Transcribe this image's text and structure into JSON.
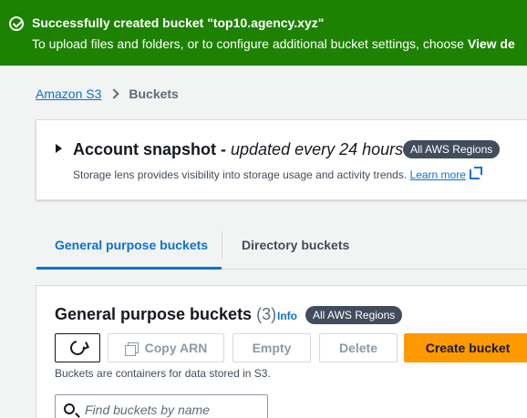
{
  "banner": {
    "title": "Successfully created bucket \"top10.agency.xyz\"",
    "message": "To upload files and folders, or to configure additional bucket settings, choose ",
    "message_bold": "View de"
  },
  "breadcrumb": {
    "root": "Amazon S3",
    "current": "Buckets"
  },
  "snapshot": {
    "title": "Account snapshot - ",
    "title_italic": "updated every 24 hours",
    "badge": "All AWS Regions",
    "description": "Storage lens provides visibility into storage usage and activity trends. ",
    "learn_more": "Learn more"
  },
  "tabs": [
    {
      "label": "General purpose buckets",
      "active": true
    },
    {
      "label": "Directory buckets",
      "active": false
    }
  ],
  "panel": {
    "title": "General purpose buckets",
    "count": "(3)",
    "info": "Info",
    "badge": "All AWS Regions",
    "description": "Buckets are containers for data stored in S3.",
    "search_placeholder": "Find buckets by name"
  },
  "toolbar": {
    "copy_arn": "Copy ARN",
    "empty": "Empty",
    "delete": "Delete",
    "create": "Create bucket"
  },
  "colors": {
    "success": "#1d8102",
    "link": "#0972d3",
    "primary": "#ff9900",
    "badge": "#414d5c"
  }
}
